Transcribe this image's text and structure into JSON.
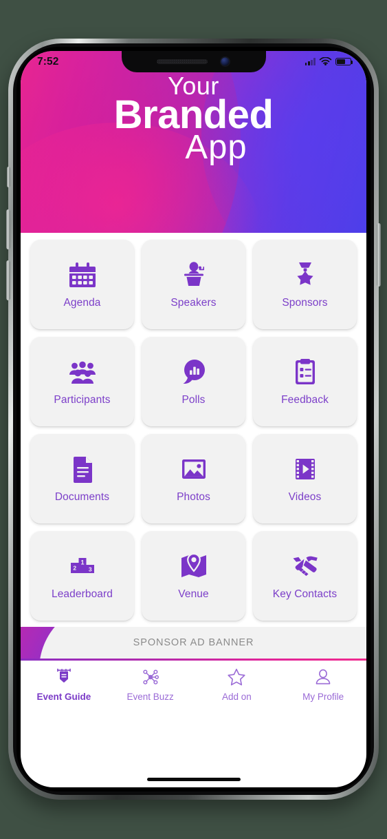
{
  "device": {
    "status_bar": {
      "clock": "7:52",
      "signal_icon": "signal-bars-icon",
      "wifi_icon": "wifi-icon",
      "battery_icon": "battery-icon"
    },
    "notch": {
      "speaker_icon": "speaker-grille-icon",
      "camera_icon": "front-camera-icon"
    },
    "home_indicator": "home-indicator"
  },
  "header": {
    "line1": "Your",
    "line2": "Branded",
    "line3": "App",
    "gradient_from": "#ff2a86",
    "gradient_mid": "#8a32d4",
    "gradient_to": "#4a3fe8"
  },
  "theme": {
    "accent_purple": "#7c3fc9",
    "icon_purple": "#7b35c8",
    "tile_bg": "#f2f2f2",
    "tab_inactive": "#9a6ad6",
    "tab_active": "#7b3bc7"
  },
  "grid": {
    "tiles": [
      {
        "label": "Agenda",
        "icon": "calendar-icon"
      },
      {
        "label": "Speakers",
        "icon": "podium-speaker-icon"
      },
      {
        "label": "Sponsors",
        "icon": "medal-star-icon"
      },
      {
        "label": "Participants",
        "icon": "people-group-icon"
      },
      {
        "label": "Polls",
        "icon": "chat-bar-chart-icon"
      },
      {
        "label": "Feedback",
        "icon": "clipboard-checklist-icon"
      },
      {
        "label": "Documents",
        "icon": "document-icon"
      },
      {
        "label": "Photos",
        "icon": "photo-image-icon"
      },
      {
        "label": "Videos",
        "icon": "film-play-icon"
      },
      {
        "label": "Leaderboard",
        "icon": "podium-ranking-icon"
      },
      {
        "label": "Venue",
        "icon": "map-pin-icon"
      },
      {
        "label": "Key Contacts",
        "icon": "handshake-icon"
      }
    ]
  },
  "sponsor_banner": {
    "text": "SPONSOR AD BANNER"
  },
  "tabbar": {
    "items": [
      {
        "label": "Event Guide",
        "icon": "banner-pennant-icon",
        "active": true
      },
      {
        "label": "Event Buzz",
        "icon": "network-nodes-icon",
        "active": false
      },
      {
        "label": "Add on",
        "icon": "star-outline-icon",
        "active": false
      },
      {
        "label": "My Profile",
        "icon": "person-outline-icon",
        "active": false
      }
    ]
  }
}
